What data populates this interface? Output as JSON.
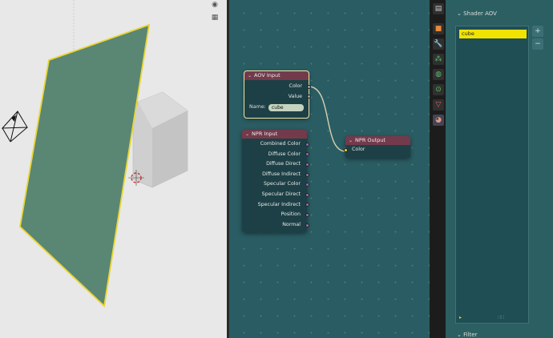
{
  "node_editor": {
    "aov_input": {
      "title": "AOV Input",
      "outputs": [
        "Color",
        "Value"
      ],
      "name_label": "Name:",
      "name_value": "cube"
    },
    "npr_input": {
      "title": "NPR Input",
      "outputs": [
        "Combined Color",
        "Diffuse Color",
        "Diffuse Direct",
        "Diffuse Indirect",
        "Specular Color",
        "Specular Direct",
        "Specular Indirect",
        "Position",
        "Normal"
      ]
    },
    "npr_output": {
      "title": "NPR Output",
      "inputs": [
        "Color"
      ]
    }
  },
  "properties": {
    "shader_aov_header": "Shader AOV",
    "aov_items": [
      "cube"
    ],
    "filter_label": "Filter"
  },
  "colors": {
    "node_header": "#733a4c",
    "editor_bg": "#2a5d63",
    "selected_item": "#f0e300",
    "plane_edge": "#e9d531"
  }
}
